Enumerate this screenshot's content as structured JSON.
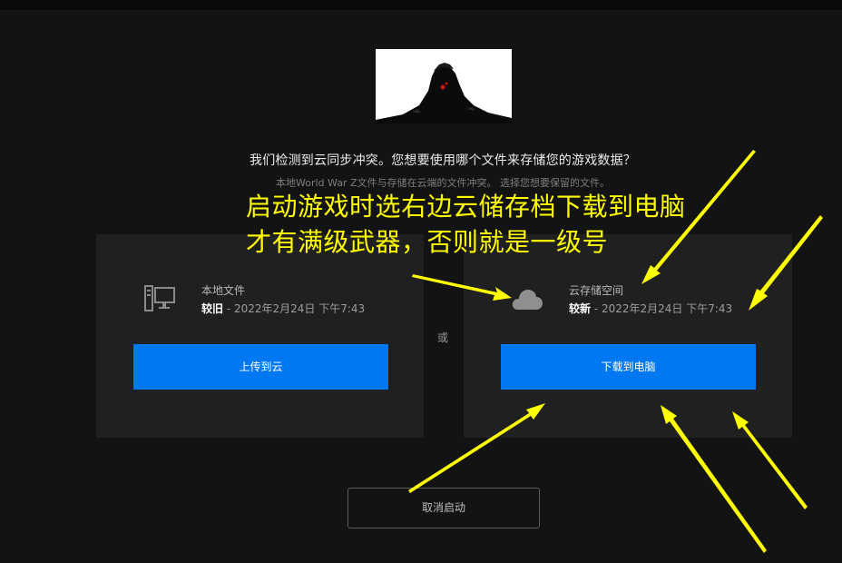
{
  "dialog": {
    "headline": "我们检测到云同步冲突。您想要使用哪个文件来存储您的游戏数据？",
    "subline": "本地World War Z文件与存储在云端的文件冲突。 选择您想要保留的文件。",
    "or_label": "或"
  },
  "local": {
    "icon": "computer-icon",
    "title": "本地文件",
    "state": "较旧",
    "timestamp": " - 2022年2月24日 下午7:43",
    "button_label": "上传到云"
  },
  "cloud": {
    "icon": "cloud-icon",
    "title": "云存储空间",
    "state": "较新",
    "timestamp": " - 2022年2月24日 下午7:43",
    "button_label": "下载到电脑"
  },
  "cancel_label": "取消启动",
  "annotation": {
    "line1": "启动游戏时选右边云储存档下载到电脑",
    "line2": "才有满级武器，否则就是一级号",
    "color": "#ffff00"
  },
  "colors": {
    "background": "#131313",
    "panel": "#202020",
    "primary_button": "#0078f2"
  }
}
